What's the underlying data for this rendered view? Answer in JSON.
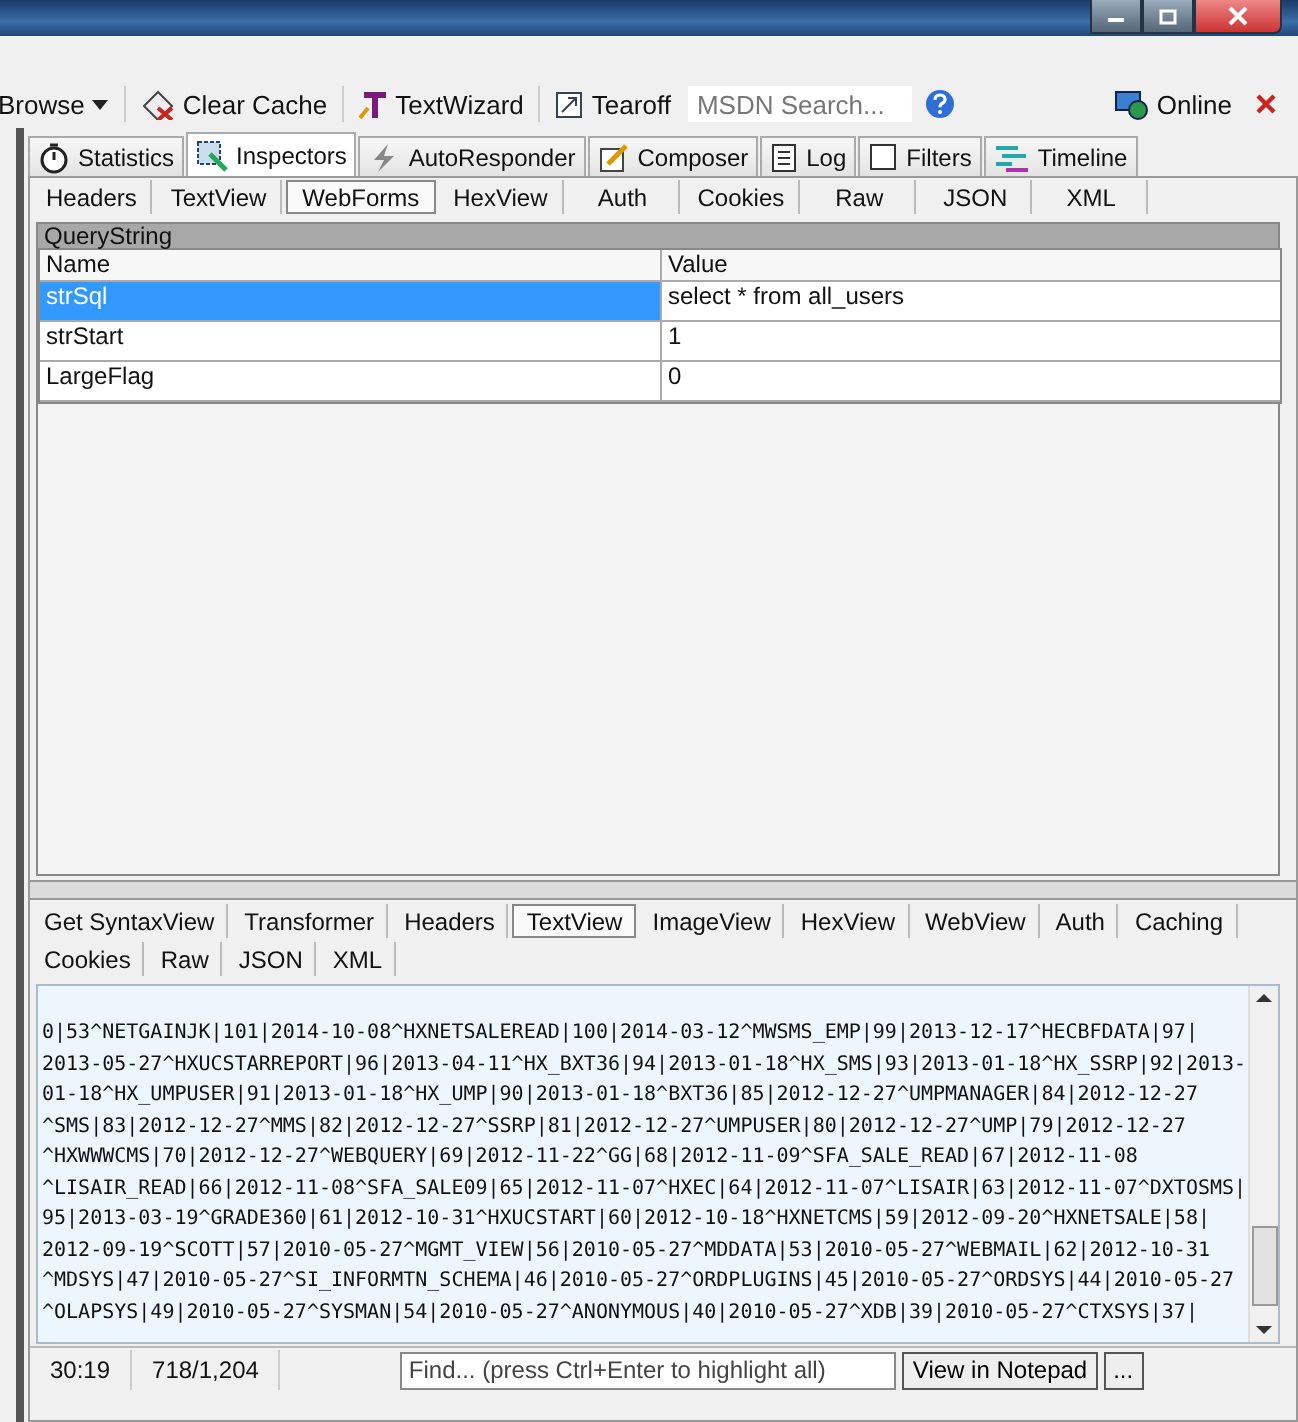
{
  "toolbar": {
    "items": [
      {
        "kind": "browse",
        "label": "Browse"
      },
      {
        "kind": "clear",
        "label": "Clear Cache"
      },
      {
        "kind": "wizard",
        "label": "TextWizard"
      },
      {
        "kind": "tearoff",
        "label": "Tearoff"
      }
    ],
    "search": {
      "placeholder": "MSDN Search..."
    },
    "online": "Online"
  },
  "tabs": [
    {
      "kind": "stopwatch",
      "label": "Statistics",
      "selected": false
    },
    {
      "kind": "inspect",
      "label": "Inspectors",
      "selected": true
    },
    {
      "kind": "bolt",
      "label": "AutoResponder",
      "selected": false
    },
    {
      "kind": "compose",
      "label": "Composer",
      "selected": false
    },
    {
      "kind": "log",
      "label": "Log",
      "selected": false
    },
    {
      "kind": "filter",
      "label": "Filters",
      "selected": false
    },
    {
      "kind": "timeline",
      "label": "Timeline",
      "selected": false
    }
  ],
  "request_tabs": [
    {
      "label": "Headers",
      "selected": false
    },
    {
      "label": "TextView",
      "selected": false
    },
    {
      "label": "WebForms",
      "selected": true
    },
    {
      "label": "HexView",
      "selected": false
    },
    {
      "label": "Auth",
      "selected": false
    },
    {
      "label": "Cookies",
      "selected": false
    },
    {
      "label": "Raw",
      "selected": false
    },
    {
      "label": "JSON",
      "selected": false
    },
    {
      "label": "XML",
      "selected": false
    }
  ],
  "query_string": {
    "title": "QueryString",
    "columns": [
      "Name",
      "Value"
    ],
    "rows": [
      {
        "name": "strSql",
        "value": "select * from all_users",
        "selected": true
      },
      {
        "name": "strStart",
        "value": "1",
        "selected": false
      },
      {
        "name": "LargeFlag",
        "value": "0",
        "selected": false
      }
    ]
  },
  "response_tabs": [
    [
      {
        "label": "Get SyntaxView",
        "selected": false
      },
      {
        "label": "Transformer",
        "selected": false
      },
      {
        "label": "Headers",
        "selected": false
      },
      {
        "label": "TextView",
        "selected": true
      },
      {
        "label": "ImageView",
        "selected": false
      },
      {
        "label": "HexView",
        "selected": false
      },
      {
        "label": "WebView",
        "selected": false
      },
      {
        "label": "Auth",
        "selected": false
      },
      {
        "label": "Caching",
        "selected": false
      }
    ],
    [
      {
        "label": "Cookies",
        "selected": false
      },
      {
        "label": "Raw",
        "selected": false
      },
      {
        "label": "JSON",
        "selected": false
      },
      {
        "label": "XML",
        "selected": false
      }
    ]
  ],
  "response_text": [
    "0|53^NETGAINJK|101|2014-10-08^HXNETSALEREAD|100|2014-03-12^MWSMS_EMP|99|2013-12-17^HECBFDATA|97|",
    "2013-05-27^HXUCSTARREPORT|96|2013-04-11^HX_BXT36|94|2013-01-18^HX_SMS|93|2013-01-18^HX_SSRP|92|2013-",
    "01-18^HX_UMPUSER|91|2013-01-18^HX_UMP|90|2013-01-18^BXT36|85|2012-12-27^UMPMANAGER|84|2012-12-27",
    "^SMS|83|2012-12-27^MMS|82|2012-12-27^SSRP|81|2012-12-27^UMPUSER|80|2012-12-27^UMP|79|2012-12-27",
    "^HXWWWCMS|70|2012-12-27^WEBQUERY|69|2012-11-22^GG|68|2012-11-09^SFA_SALE_READ|67|2012-11-08",
    "^LISAIR_READ|66|2012-11-08^SFA_SALE09|65|2012-11-07^HXEC|64|2012-11-07^LISAIR|63|2012-11-07^DXTOSMS|",
    "95|2013-03-19^GRADE360|61|2012-10-31^HXUCSTART|60|2012-10-18^HXNETCMS|59|2012-09-20^HXNETSALE|58|",
    "2012-09-19^SCOTT|57|2010-05-27^MGMT_VIEW|56|2010-05-27^MDDATA|53|2010-05-27^WEBMAIL|62|2012-10-31",
    "^MDSYS|47|2010-05-27^SI_INFORMTN_SCHEMA|46|2010-05-27^ORDPLUGINS|45|2010-05-27^ORDSYS|44|2010-05-27",
    "^OLAPSYS|49|2010-05-27^SYSMAN|54|2010-05-27^ANONYMOUS|40|2010-05-27^XDB|39|2010-05-27^CTXSYS|37|"
  ],
  "status_bar": {
    "position": "30:19",
    "size": "718/1,204",
    "find": {
      "placeholder": "Find... (press Ctrl+Enter to highlight all)"
    },
    "buttons": [
      "View in Notepad",
      "..."
    ]
  }
}
